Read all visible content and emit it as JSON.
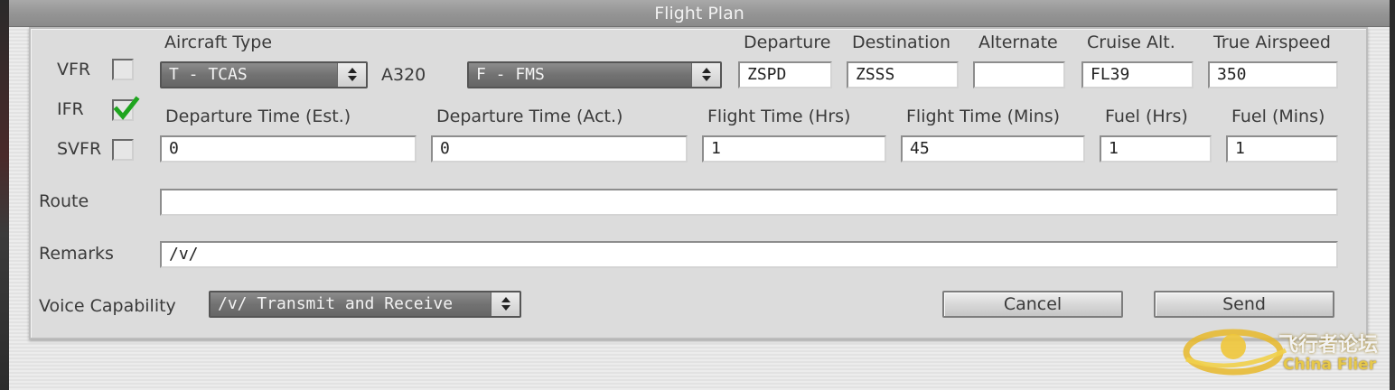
{
  "window": {
    "title": "Flight Plan"
  },
  "flight_rules": {
    "vfr": {
      "label": "VFR",
      "checked": false
    },
    "ifr": {
      "label": "IFR",
      "checked": true
    },
    "svfr": {
      "label": "SVFR",
      "checked": false
    }
  },
  "aircraft": {
    "type_label": "Aircraft Type",
    "equipment_selected": "T - TCAS",
    "type_value": "A320",
    "nav_selected": "F - FMS"
  },
  "route_fields": {
    "departure": {
      "label": "Departure",
      "value": "ZSPD"
    },
    "destination": {
      "label": "Destination",
      "value": "ZSSS"
    },
    "alternate": {
      "label": "Alternate",
      "value": ""
    },
    "cruise_alt": {
      "label": "Cruise Alt.",
      "value": "FL39"
    },
    "true_airspeed": {
      "label": "True Airspeed",
      "value": "350"
    }
  },
  "time_fields": {
    "dep_time_est": {
      "label": "Departure Time (Est.)",
      "value": "0"
    },
    "dep_time_act": {
      "label": "Departure Time (Act.)",
      "value": "0"
    },
    "flight_time_hrs": {
      "label": "Flight Time (Hrs)",
      "value": "1"
    },
    "flight_time_mins": {
      "label": "Flight Time (Mins)",
      "value": "45"
    },
    "fuel_hrs": {
      "label": "Fuel (Hrs)",
      "value": "1"
    },
    "fuel_mins": {
      "label": "Fuel (Mins)",
      "value": "1"
    }
  },
  "route": {
    "label": "Route",
    "value": ""
  },
  "remarks": {
    "label": "Remarks",
    "value": "/v/"
  },
  "voice": {
    "label": "Voice Capability",
    "selected": "/v/ Transmit and Receive"
  },
  "buttons": {
    "cancel": "Cancel",
    "send": "Send"
  },
  "watermark": {
    "cn": "飞行者论坛",
    "en": "China Flier"
  },
  "colors": {
    "check_mark": "#1fa51f",
    "title_bar": "#959595"
  }
}
